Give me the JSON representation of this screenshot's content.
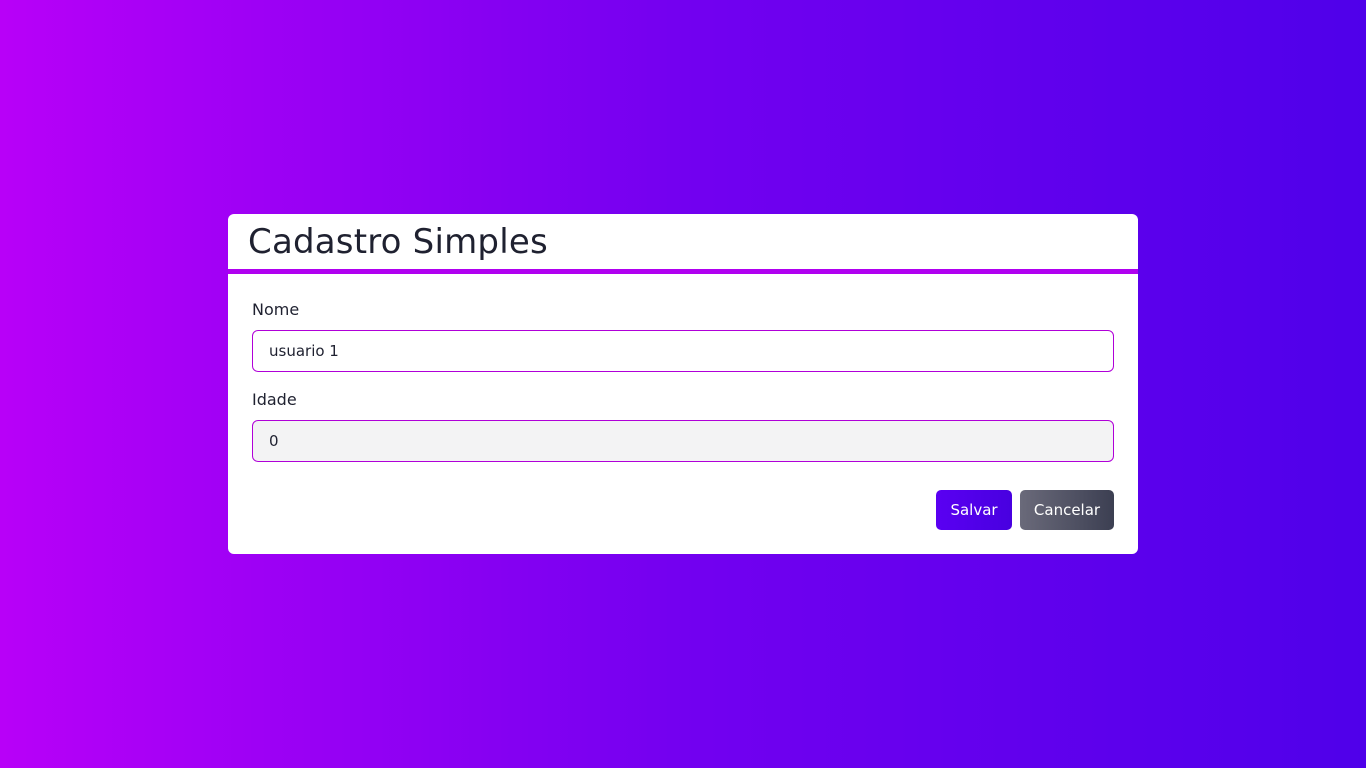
{
  "form": {
    "title": "Cadastro Simples",
    "fields": {
      "nome": {
        "label": "Nome",
        "value": "usuario 1"
      },
      "idade": {
        "label": "Idade",
        "value": "0"
      }
    },
    "actions": {
      "save_label": "Salvar",
      "cancel_label": "Cancelar"
    }
  },
  "colors": {
    "background_gradient_start": "#b800f8",
    "background_gradient_end": "#4f00ea",
    "accent": "#b000f0",
    "save_button": "#5200ee",
    "cancel_button": "#4e5063"
  }
}
